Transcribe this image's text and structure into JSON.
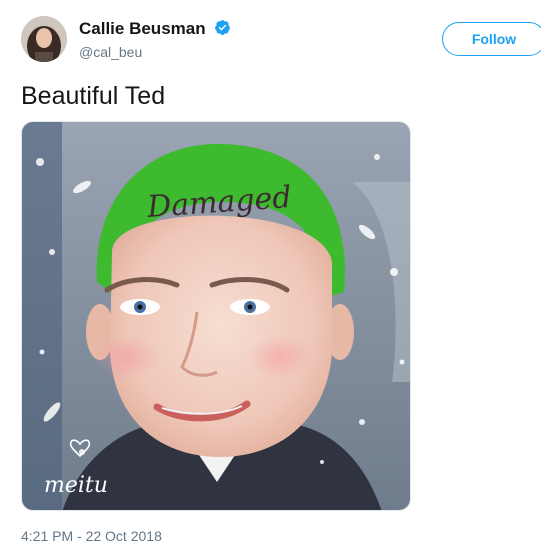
{
  "user": {
    "display_name": "Callie Beusman",
    "handle": "@cal_beu",
    "verified": true
  },
  "follow_button": {
    "label": "Follow"
  },
  "tweet": {
    "text": "Beautiful Ted",
    "timestamp": "4:21 PM - 22 Oct 2018"
  },
  "media": {
    "forehead_text": "Damaged",
    "watermark_text": "meitu"
  },
  "colors": {
    "accent": "#1da1f2",
    "hair": "#3dba2e",
    "muted_text": "#657786"
  },
  "icons": [
    "verified-badge-icon",
    "heart-icon"
  ]
}
